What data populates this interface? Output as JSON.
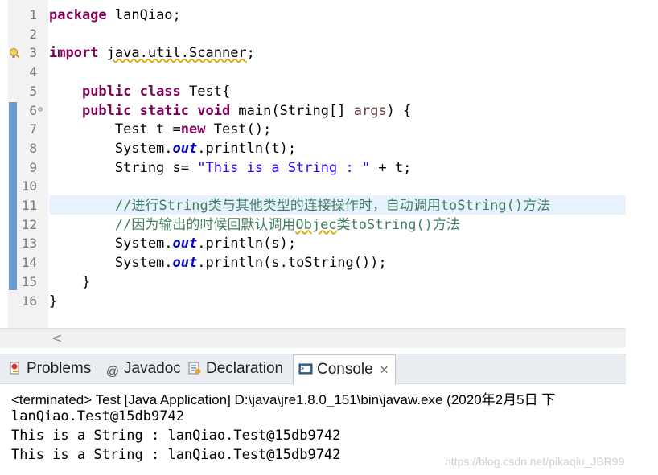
{
  "editor": {
    "line_numbers": [
      "1",
      "2",
      "3",
      "4",
      "5",
      "6",
      "7",
      "8",
      "9",
      "10",
      "11",
      "12",
      "13",
      "14",
      "15",
      "16"
    ],
    "lines": [
      {
        "segments": [
          {
            "t": "package",
            "c": "kw"
          },
          {
            "t": " lanQiao;",
            "c": ""
          }
        ]
      },
      {
        "segments": []
      },
      {
        "segments": [
          {
            "t": "import",
            "c": "kw"
          },
          {
            "t": " ",
            "c": ""
          },
          {
            "t": "java.util.Scanner",
            "c": "warn-underline"
          },
          {
            "t": ";",
            "c": ""
          }
        ]
      },
      {
        "segments": []
      },
      {
        "segments": [
          {
            "t": "    ",
            "c": ""
          },
          {
            "t": "public class",
            "c": "kw"
          },
          {
            "t": " Test{",
            "c": ""
          }
        ]
      },
      {
        "segments": [
          {
            "t": "    ",
            "c": ""
          },
          {
            "t": "public static void",
            "c": "kw"
          },
          {
            "t": " main(String[] ",
            "c": ""
          },
          {
            "t": "args",
            "c": "arg"
          },
          {
            "t": ") {",
            "c": ""
          }
        ]
      },
      {
        "segments": [
          {
            "t": "        Test t =",
            "c": ""
          },
          {
            "t": "new",
            "c": "kw"
          },
          {
            "t": " Test();",
            "c": ""
          }
        ]
      },
      {
        "segments": [
          {
            "t": "        System.",
            "c": ""
          },
          {
            "t": "out",
            "c": "fld"
          },
          {
            "t": ".println(t);",
            "c": ""
          }
        ]
      },
      {
        "segments": [
          {
            "t": "        String s= ",
            "c": ""
          },
          {
            "t": "\"This is a String : \"",
            "c": "str"
          },
          {
            "t": " + t;",
            "c": ""
          }
        ]
      },
      {
        "segments": []
      },
      {
        "segments": [
          {
            "t": "        //进行String类与其他类型的连接操作时，自动调用toString()方法",
            "c": "cmt"
          }
        ]
      },
      {
        "segments": [
          {
            "t": "        //因为输出的时候回默认调用",
            "c": "cmt"
          },
          {
            "t": "Objec",
            "c": "cmt warn-underline"
          },
          {
            "t": "类toString()方法",
            "c": "cmt"
          }
        ]
      },
      {
        "segments": [
          {
            "t": "        System.",
            "c": ""
          },
          {
            "t": "out",
            "c": "fld"
          },
          {
            "t": ".println(s);",
            "c": ""
          }
        ]
      },
      {
        "segments": [
          {
            "t": "        System.",
            "c": ""
          },
          {
            "t": "out",
            "c": "fld"
          },
          {
            "t": ".println(s.toString());",
            "c": ""
          }
        ]
      },
      {
        "segments": [
          {
            "t": "    }",
            "c": ""
          }
        ]
      },
      {
        "segments": [
          {
            "t": "}",
            "c": ""
          }
        ]
      }
    ],
    "scroll_left_glyph": "<",
    "fold_glyph": "⊖"
  },
  "panel": {
    "tabs": [
      {
        "label": "Problems",
        "icon": "problems-icon"
      },
      {
        "label": "Javadoc",
        "icon": "at-sign-icon",
        "glyph": "@"
      },
      {
        "label": "Declaration",
        "icon": "declaration-icon"
      },
      {
        "label": "Console",
        "icon": "console-icon",
        "active": true
      }
    ],
    "close_glyph": "✕",
    "console_header": "<terminated> Test [Java Application] D:\\java\\jre1.8.0_151\\bin\\javaw.exe (2020年2月5日 下",
    "output": [
      "lanQiao.Test@15db9742",
      "This is a String : lanQiao.Test@15db9742",
      "This is a String : lanQiao.Test@15db9742"
    ]
  },
  "watermark": "https://blog.csdn.net/pikaqiu_JBR99",
  "colors": {
    "keyword": "#7f0055",
    "string": "#2a00ff",
    "comment": "#3f7f5f",
    "field": "#0000c0",
    "change_bar": "#6b9bd1"
  }
}
